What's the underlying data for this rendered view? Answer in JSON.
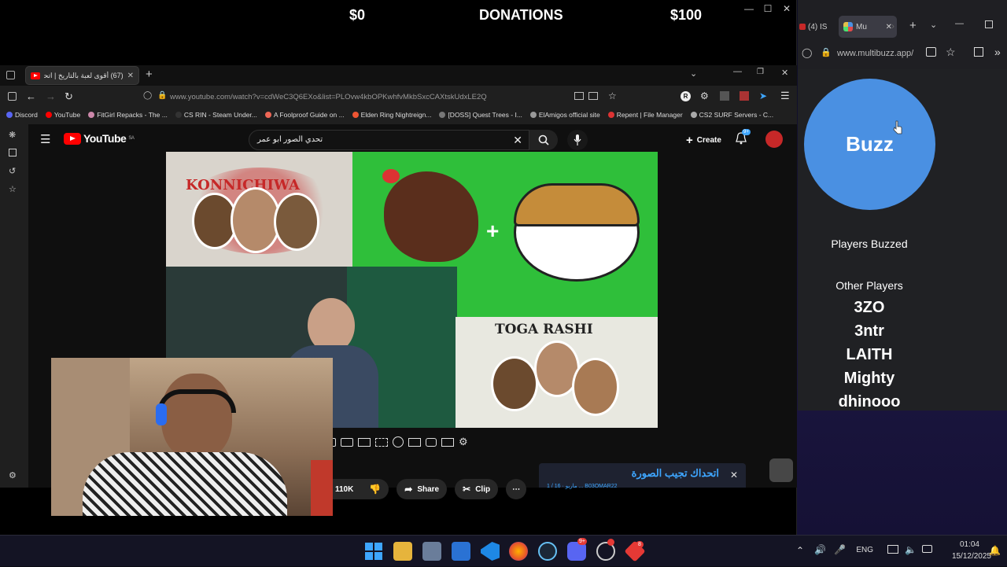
{
  "overlay": {
    "donations_min": "$0",
    "donations_title": "DONATIONS",
    "donations_max": "$100"
  },
  "browser": {
    "tab_title": "(67) أقوى لعبة بالتاريخ | اتحد...",
    "url": "www.youtube.com/watch?v=cdWeC3Q6EXo&list=PLOvw4kbOPKwhfvMkbSxcCAXtskUdxLE2Q",
    "bookmarks": [
      "Discord",
      "YouTube",
      "FitGirl Repacks - The ...",
      "CS RIN - Steam Under...",
      "A Foolproof Guide on ...",
      "Elden Ring Nightreign...",
      "[DOSS] Quest Trees - I...",
      "ElAmigos official site",
      "Repent | File Manager",
      "CS2 SURF Servers - C..."
    ]
  },
  "youtube": {
    "logo_text": "YouTube",
    "logo_region": "SA",
    "search_value": "تحدي الصور ابو عمر",
    "create_label": "Create",
    "notif_count": "9+",
    "like_count": "110K",
    "share_label": "Share",
    "clip_label": "Clip",
    "thumb_text_1": "KONNICHIWA",
    "thumb_text_2": "TOGA RASHI",
    "popup_title": "اتحداك تجيب الصورة",
    "popup_sub": "1 / 16 · ماريو ... B03OMAR22"
  },
  "multibuzz": {
    "tab1_label": "(4) IS",
    "tab2_label": "Mu",
    "url": "www.multibuzz.app/",
    "buzz_label": "Buzz",
    "players_buzzed_label": "Players Buzzed",
    "other_players_label": "Other Players",
    "players": [
      "3ZO",
      "3ntr",
      "LAITH",
      "Mighty",
      "dhinooo"
    ]
  },
  "taskbar": {
    "lang": "ENG",
    "time": "01:04",
    "date": "15/12/2025",
    "discord_badge": "9+",
    "app_badge": "8"
  },
  "colors": {
    "buzz": "#4a90e2",
    "yt_red": "#ff0000",
    "popup_text": "#3ea6ff"
  }
}
